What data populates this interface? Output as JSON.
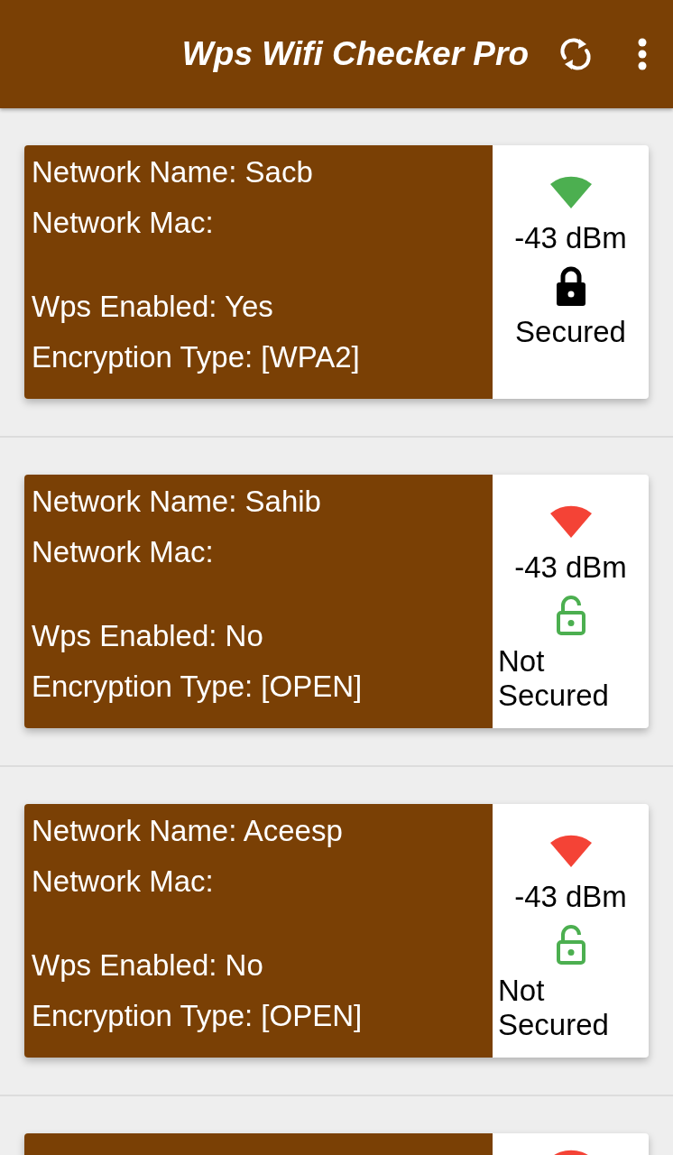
{
  "app_bar": {
    "title": "Wps Wifi Checker Pro"
  },
  "networks": [
    {
      "name": "Network Name: Sacb",
      "mac": "Network Mac:",
      "wps": "Wps Enabled: Yes",
      "encryption": "Encryption Type: [WPA2]",
      "color": "#4caf50",
      "signal": "-43 dBm",
      "secured": true,
      "security": "Secured"
    },
    {
      "name": "Network Name: Sahib",
      "mac": "Network Mac:",
      "wps": "Wps Enabled: No",
      "encryption": "Encryption Type: [OPEN]",
      "color": "#f44336",
      "signal": "-43 dBm",
      "secured": false,
      "security": "Not Secured"
    },
    {
      "name": "Network Name: Aceesp",
      "mac": "Network Mac:",
      "wps": "Wps Enabled: No",
      "encryption": "Encryption Type: [OPEN]",
      "color": "#f44336",
      "signal": "-43 dBm",
      "secured": false,
      "security": "Not Secured"
    },
    {
      "color": "#f44336"
    }
  ]
}
